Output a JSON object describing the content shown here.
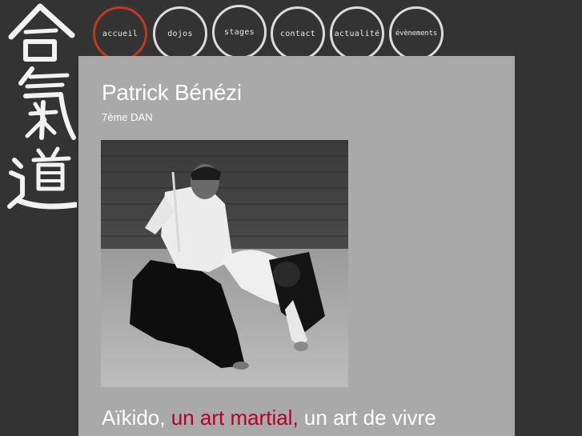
{
  "logo": {
    "icon": "aikido-kanji-icon"
  },
  "nav": {
    "items": [
      {
        "label": "accueil",
        "active": true
      },
      {
        "label": "dojos",
        "active": false
      },
      {
        "label": "stages",
        "active": false
      },
      {
        "label": "contact",
        "active": false
      },
      {
        "label": "actualité",
        "active": false
      },
      {
        "label": "évènements",
        "active": false
      }
    ]
  },
  "main": {
    "title": "Patrick Bénézi",
    "subtitle": "7ème DAN",
    "photo": {
      "icon": "aikido-photo"
    },
    "tagline": {
      "part1": "Aïkido,",
      "part2": "un art martial,",
      "part3": "un art de vivre"
    }
  },
  "colors": {
    "background": "#333333",
    "panel": "#a9a9a9",
    "active_ring": "#c0391f",
    "accent_text": "#b3002b"
  }
}
